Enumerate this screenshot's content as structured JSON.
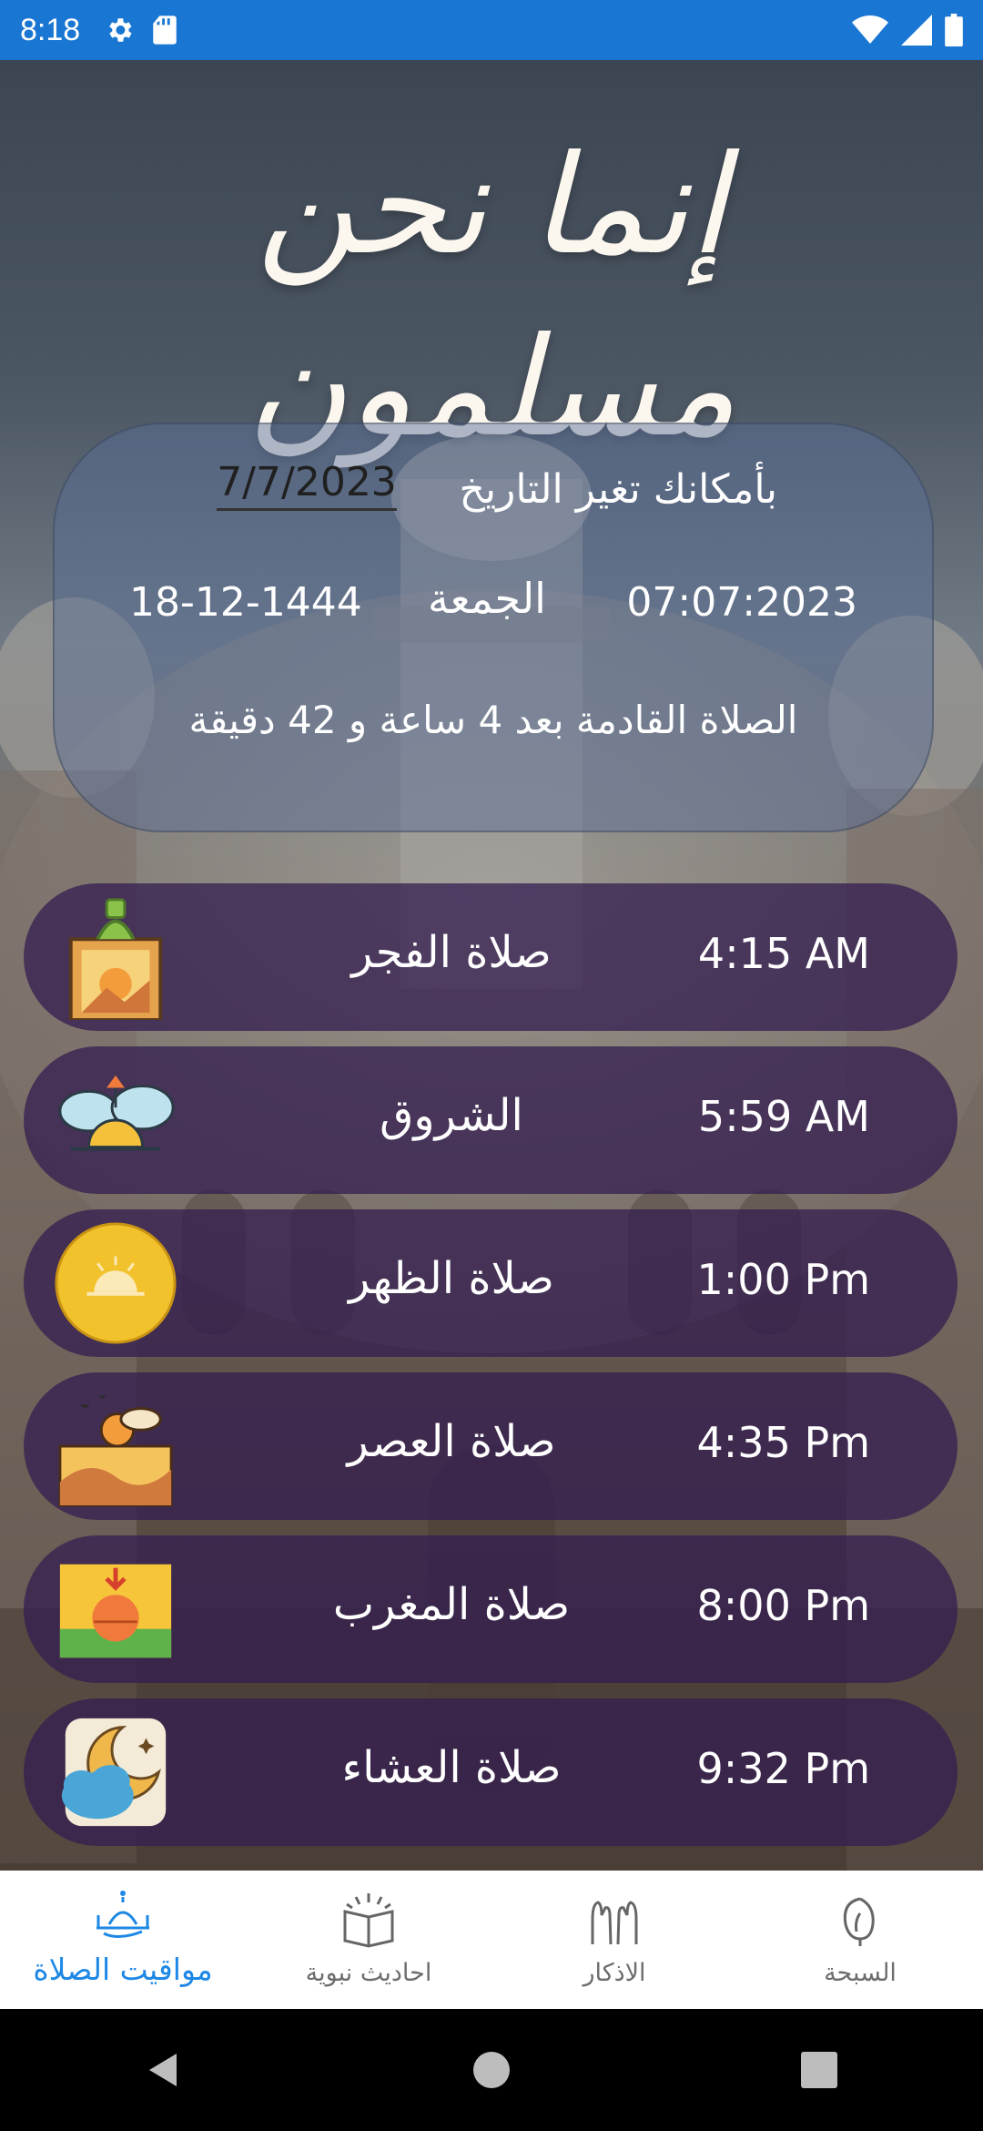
{
  "status_bar": {
    "time": "8:18"
  },
  "app": {
    "title": "إنما نحن مسلمون"
  },
  "date_card": {
    "change_date_label": "بأمكانك تغير التاريخ",
    "selected_date": "7/7/2023",
    "gregorian_date": "07:07:2023",
    "day_name": "الجمعة",
    "hijri_date": "18-12-1444",
    "next_prayer_text": "الصلاة القادمة بعد 4 ساعة و 42 دقيقة"
  },
  "prayers": [
    {
      "name": "صلاة الفجر",
      "time": "4:15 AM",
      "icon": "fajr-dawn-icon"
    },
    {
      "name": "الشروق",
      "time": "5:59 AM",
      "icon": "sunrise-icon"
    },
    {
      "name": "صلاة الظهر",
      "time": "1:00 Pm",
      "icon": "noon-sun-icon"
    },
    {
      "name": "صلاة العصر",
      "time": "4:35 Pm",
      "icon": "afternoon-desert-icon"
    },
    {
      "name": "صلاة المغرب",
      "time": "8:00 Pm",
      "icon": "sunset-icon"
    },
    {
      "name": "صلاة العشاء",
      "time": "9:32 Pm",
      "icon": "night-moon-cloud-icon"
    }
  ],
  "bottom_nav": {
    "items": [
      {
        "label": "مواقيت الصلاة",
        "icon": "mosque-icon",
        "active": true
      },
      {
        "label": "احاديث نبوية",
        "icon": "open-book-icon",
        "active": false
      },
      {
        "label": "الاذكار",
        "icon": "praying-hands-icon",
        "active": false
      },
      {
        "label": "السبحة",
        "icon": "prayer-beads-icon",
        "active": false
      }
    ]
  },
  "colors": {
    "status_bar": "#1976d2",
    "active_nav": "#1e88e5",
    "prayer_row_bg": "#341e50"
  }
}
